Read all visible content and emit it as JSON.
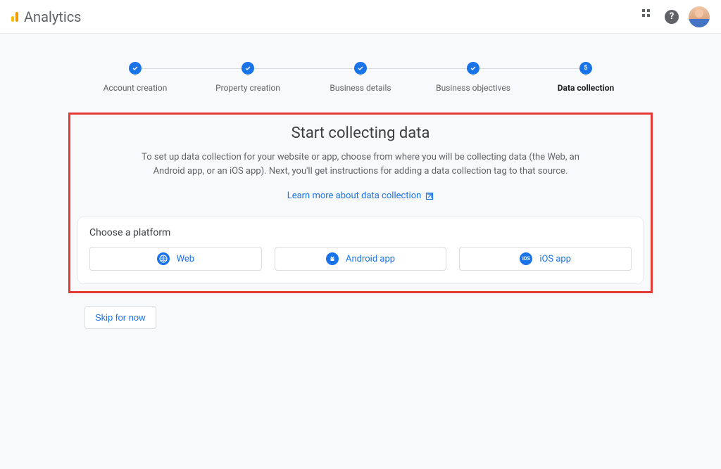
{
  "header": {
    "app_title": "Analytics"
  },
  "stepper": {
    "steps": [
      {
        "label": "Account creation",
        "done": true
      },
      {
        "label": "Property creation",
        "done": true
      },
      {
        "label": "Business details",
        "done": true
      },
      {
        "label": "Business objectives",
        "done": true
      },
      {
        "label": "Data collection",
        "done": false,
        "active": true,
        "number": "5"
      }
    ]
  },
  "content": {
    "title": "Start collecting data",
    "description": "To set up data collection for your website or app, choose from where you will be collecting data (the Web, an Android app, or an iOS app). Next, you'll get instructions for adding a data collection tag to that source.",
    "learn_more": "Learn more about data collection",
    "platform_title": "Choose a platform",
    "platforms": {
      "web": "Web",
      "android": "Android app",
      "ios": "iOS app",
      "ios_badge": "iOS"
    }
  },
  "actions": {
    "skip": "Skip for now"
  }
}
